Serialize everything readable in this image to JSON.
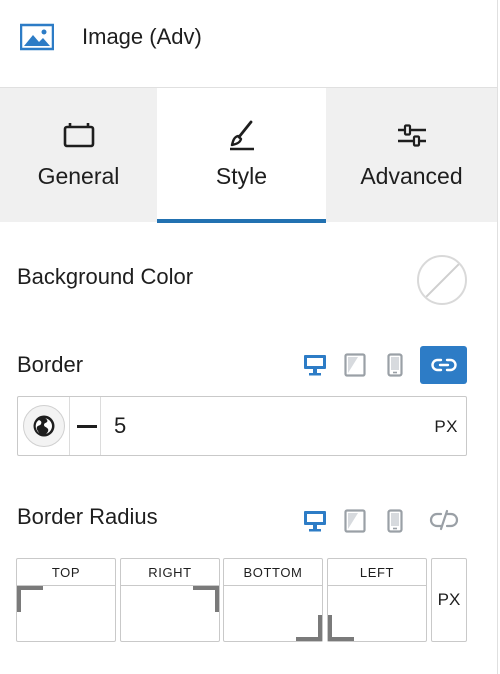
{
  "header": {
    "title": "Image (Adv)",
    "icon": "image-icon"
  },
  "tabs": [
    {
      "label": "General",
      "icon": "panel-icon",
      "active": false
    },
    {
      "label": "Style",
      "icon": "brush-icon",
      "active": true
    },
    {
      "label": "Advanced",
      "icon": "sliders-icon",
      "active": false
    }
  ],
  "background_color": {
    "label": "Background Color",
    "value": "none"
  },
  "border": {
    "label": "Border",
    "devices": [
      "desktop-icon",
      "tablet-icon",
      "mobile-icon"
    ],
    "active_device": "desktop",
    "linked": true,
    "width_value": "5",
    "unit": "PX"
  },
  "border_radius": {
    "label": "Border Radius",
    "devices": [
      "desktop-icon",
      "tablet-icon",
      "mobile-icon"
    ],
    "active_device": "desktop",
    "linked": false,
    "fields": [
      {
        "label": "TOP",
        "value": ""
      },
      {
        "label": "RIGHT",
        "value": ""
      },
      {
        "label": "BOTTOM",
        "value": ""
      },
      {
        "label": "LEFT",
        "value": ""
      }
    ],
    "unit": "PX"
  },
  "colors": {
    "accent": "#2d7cc6",
    "tab_underline": "#2271b1",
    "tab_bg": "#f0f0f0",
    "inactive_icon": "#9aa0a6"
  }
}
